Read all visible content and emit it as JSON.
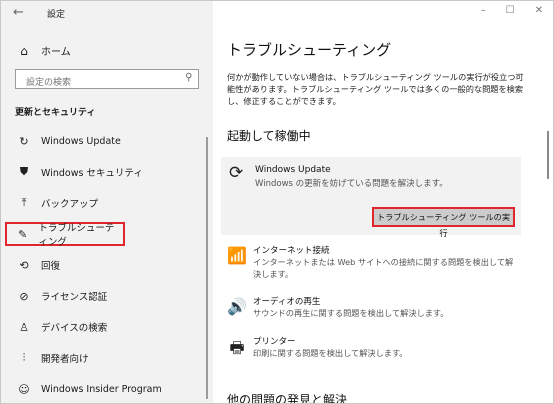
{
  "window": {
    "title": "設定",
    "controls": [
      "–",
      "☐",
      "✕"
    ]
  },
  "sidebar": {
    "back_icon": "←",
    "home_label": "ホーム",
    "search_placeholder": "設定の検索",
    "section_title": "更新とセキュリティ",
    "items": [
      {
        "label": "Windows Update",
        "icon": "refresh-icon",
        "glyph": "↻"
      },
      {
        "label": "Windows セキュリティ",
        "icon": "shield-icon",
        "glyph": "⛊"
      },
      {
        "label": "バックアップ",
        "icon": "backup-icon",
        "glyph": "⤒"
      },
      {
        "label": "トラブルシューティング",
        "icon": "wrench-icon",
        "glyph": "✎",
        "selected": true
      },
      {
        "label": "回復",
        "icon": "recovery-icon",
        "glyph": "⟲"
      },
      {
        "label": "ライセンス認証",
        "icon": "check-circle-icon",
        "glyph": "⊘"
      },
      {
        "label": "デバイスの検索",
        "icon": "find-device-icon",
        "glyph": "♙"
      },
      {
        "label": "開発者向け",
        "icon": "developer-icon",
        "glyph": "⫶"
      },
      {
        "label": "Windows Insider Program",
        "icon": "insider-icon",
        "glyph": "☺"
      }
    ]
  },
  "main": {
    "title": "トラブルシューティング",
    "intro": "何かが動作していない場合は、トラブルシューティング ツールの実行が役立つ可能性があります。トラブルシューティング ツールでは多くの一般的な問題を検索し、修正することができます。",
    "running_heading": "起動して稼働中",
    "windows_update": {
      "title": "Windows Update",
      "description": "Windows の更新を妨げている問題を解決します。",
      "run_button": "トラブルシューティング ツールの実行"
    },
    "tools": [
      {
        "name": "インターネット接続",
        "description": "インターネットまたは Web サイトへの接続に関する問題を検出して解決します。",
        "icon": "wifi-icon",
        "glyph": "📶"
      },
      {
        "name": "オーディオの再生",
        "description": "サウンドの再生に関する問題を検出して解決します。",
        "icon": "speaker-icon",
        "glyph": "🔊"
      },
      {
        "name": "プリンター",
        "description": "印刷に関する問題を検出して解決します。",
        "icon": "printer-icon",
        "glyph": "🖶"
      }
    ],
    "bottom_heading": "他の問題の発見と解決"
  },
  "colors": {
    "highlight_border": "#e0252c",
    "sidebar_bg": "#f2f2f2",
    "button_bg": "#cccccc"
  }
}
